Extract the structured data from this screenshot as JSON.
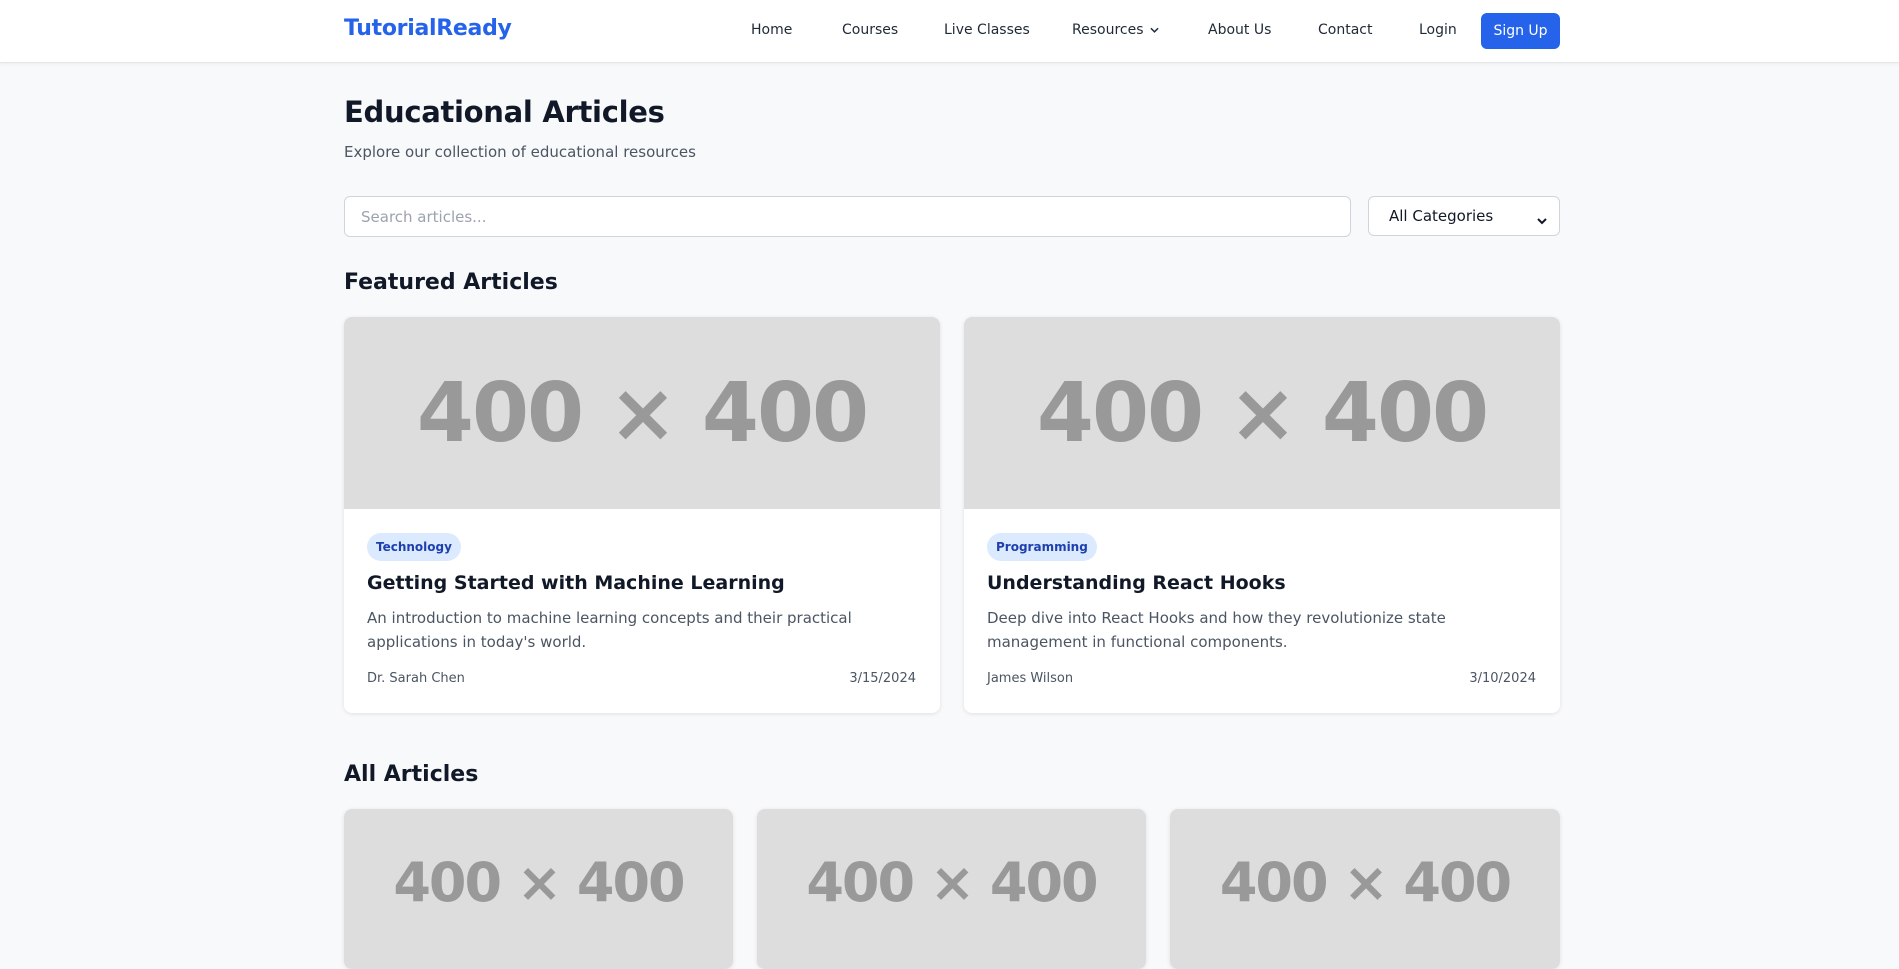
{
  "nav": {
    "logo": "TutorialReady",
    "links": [
      "Home",
      "Courses",
      "Live Classes",
      "Resources",
      "About Us",
      "Contact"
    ],
    "login": "Login",
    "signup": "Sign Up"
  },
  "header": {
    "title": "Educational Articles",
    "subtitle": "Explore our collection of educational resources"
  },
  "filters": {
    "search_placeholder": "Search articles...",
    "category_selected": "All Categories"
  },
  "featured": {
    "title": "Featured Articles",
    "articles": [
      {
        "image_text": "400 × 400",
        "category": "Technology",
        "title": "Getting Started with Machine Learning",
        "description": "An introduction to machine learning concepts and their practical applications in today's world.",
        "author": "Dr. Sarah Chen",
        "date": "3/15/2024"
      },
      {
        "image_text": "400 × 400",
        "category": "Programming",
        "title": "Understanding React Hooks",
        "description": "Deep dive into React Hooks and how they revolutionize state management in functional components.",
        "author": "James Wilson",
        "date": "3/10/2024"
      }
    ]
  },
  "all_articles": {
    "title": "All Articles",
    "articles": [
      {
        "image_text": "400 × 400"
      },
      {
        "image_text": "400 × 400"
      },
      {
        "image_text": "400 × 400"
      }
    ]
  },
  "colors": {
    "brand": "#2563eb",
    "badge_bg": "#dbeafe",
    "badge_text": "#1e40af",
    "placeholder_bg": "#dddddd"
  }
}
